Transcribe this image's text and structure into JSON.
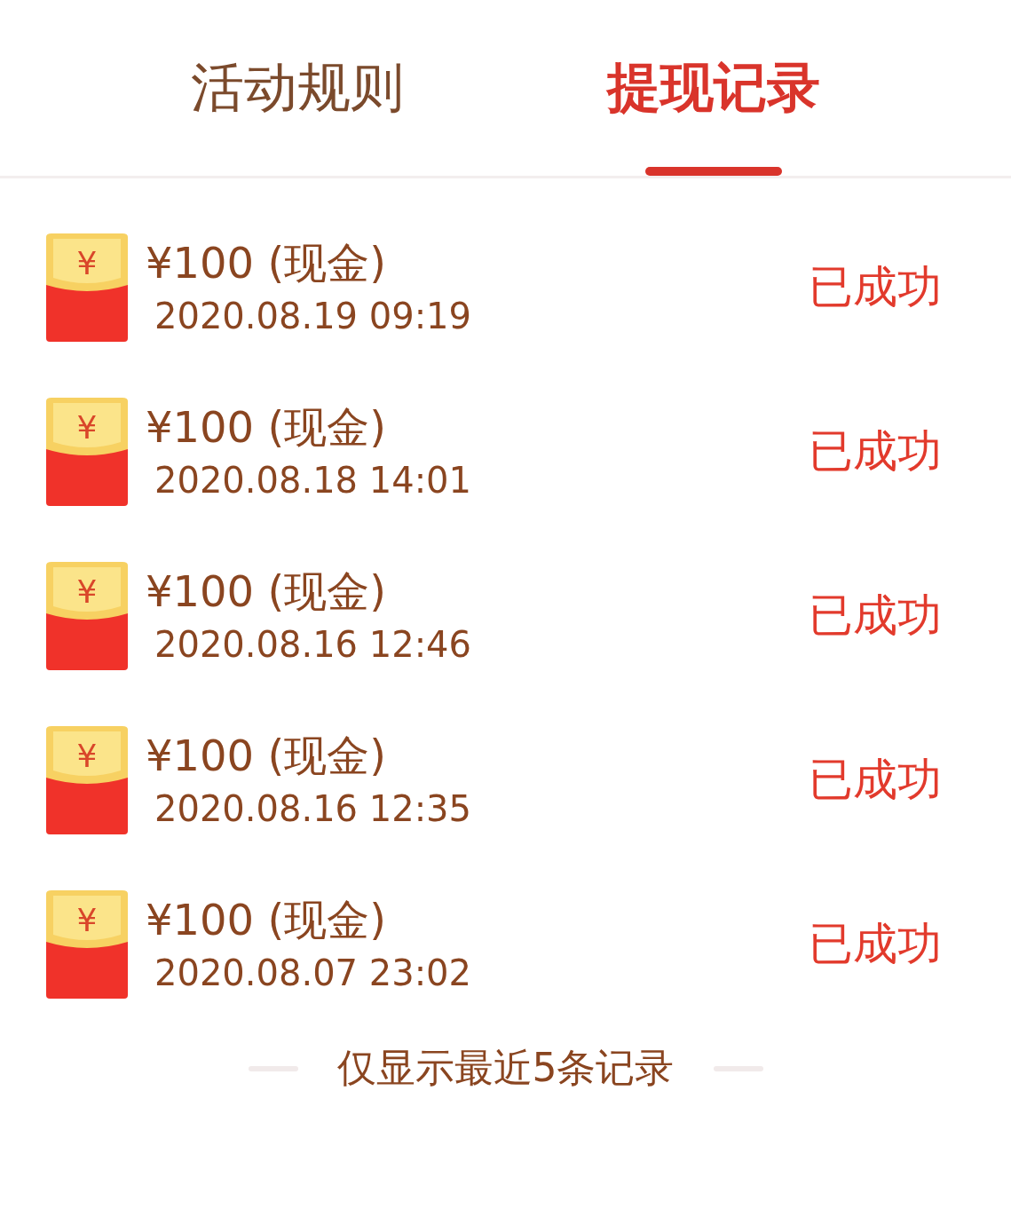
{
  "tabs": [
    {
      "label": "活动规则",
      "selected": false
    },
    {
      "label": "提现记录",
      "selected": true
    }
  ],
  "records": [
    {
      "icon_symbol": "¥",
      "amount": "¥100 (现金)",
      "time": "2020.08.19 09:19",
      "status": "已成功"
    },
    {
      "icon_symbol": "¥",
      "amount": "¥100 (现金)",
      "time": "2020.08.18 14:01",
      "status": "已成功"
    },
    {
      "icon_symbol": "¥",
      "amount": "¥100 (现金)",
      "time": "2020.08.16 12:46",
      "status": "已成功"
    },
    {
      "icon_symbol": "¥",
      "amount": "¥100 (现金)",
      "time": "2020.08.16 12:35",
      "status": "已成功"
    },
    {
      "icon_symbol": "¥",
      "amount": "¥100 (现金)",
      "time": "2020.08.07 23:02",
      "status": "已成功"
    }
  ],
  "footer_note": "仅显示最近5条记录"
}
